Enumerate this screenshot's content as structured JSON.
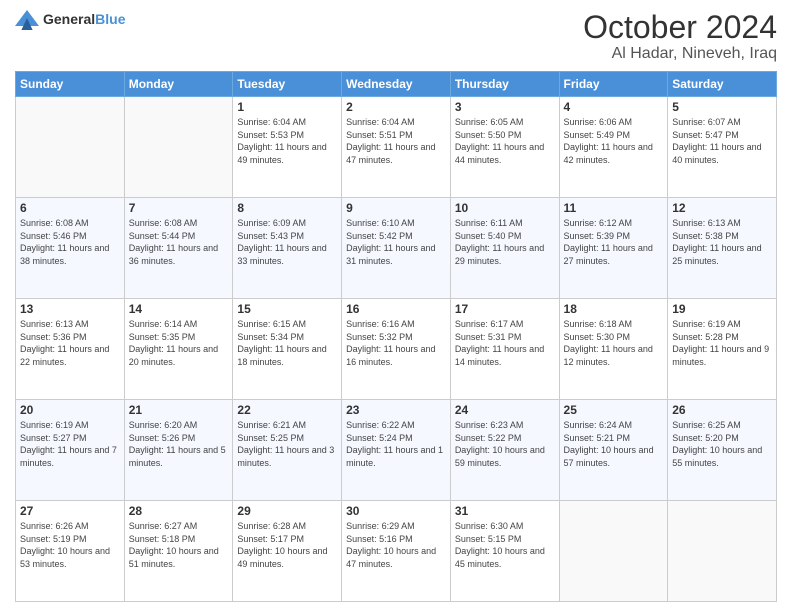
{
  "header": {
    "logo_general": "General",
    "logo_blue": "Blue",
    "month_title": "October 2024",
    "location": "Al Hadar, Nineveh, Iraq"
  },
  "weekdays": [
    "Sunday",
    "Monday",
    "Tuesday",
    "Wednesday",
    "Thursday",
    "Friday",
    "Saturday"
  ],
  "weeks": [
    [
      {
        "day": "",
        "sunrise": "",
        "sunset": "",
        "daylight": ""
      },
      {
        "day": "",
        "sunrise": "",
        "sunset": "",
        "daylight": ""
      },
      {
        "day": "1",
        "sunrise": "Sunrise: 6:04 AM",
        "sunset": "Sunset: 5:53 PM",
        "daylight": "Daylight: 11 hours and 49 minutes."
      },
      {
        "day": "2",
        "sunrise": "Sunrise: 6:04 AM",
        "sunset": "Sunset: 5:51 PM",
        "daylight": "Daylight: 11 hours and 47 minutes."
      },
      {
        "day": "3",
        "sunrise": "Sunrise: 6:05 AM",
        "sunset": "Sunset: 5:50 PM",
        "daylight": "Daylight: 11 hours and 44 minutes."
      },
      {
        "day": "4",
        "sunrise": "Sunrise: 6:06 AM",
        "sunset": "Sunset: 5:49 PM",
        "daylight": "Daylight: 11 hours and 42 minutes."
      },
      {
        "day": "5",
        "sunrise": "Sunrise: 6:07 AM",
        "sunset": "Sunset: 5:47 PM",
        "daylight": "Daylight: 11 hours and 40 minutes."
      }
    ],
    [
      {
        "day": "6",
        "sunrise": "Sunrise: 6:08 AM",
        "sunset": "Sunset: 5:46 PM",
        "daylight": "Daylight: 11 hours and 38 minutes."
      },
      {
        "day": "7",
        "sunrise": "Sunrise: 6:08 AM",
        "sunset": "Sunset: 5:44 PM",
        "daylight": "Daylight: 11 hours and 36 minutes."
      },
      {
        "day": "8",
        "sunrise": "Sunrise: 6:09 AM",
        "sunset": "Sunset: 5:43 PM",
        "daylight": "Daylight: 11 hours and 33 minutes."
      },
      {
        "day": "9",
        "sunrise": "Sunrise: 6:10 AM",
        "sunset": "Sunset: 5:42 PM",
        "daylight": "Daylight: 11 hours and 31 minutes."
      },
      {
        "day": "10",
        "sunrise": "Sunrise: 6:11 AM",
        "sunset": "Sunset: 5:40 PM",
        "daylight": "Daylight: 11 hours and 29 minutes."
      },
      {
        "day": "11",
        "sunrise": "Sunrise: 6:12 AM",
        "sunset": "Sunset: 5:39 PM",
        "daylight": "Daylight: 11 hours and 27 minutes."
      },
      {
        "day": "12",
        "sunrise": "Sunrise: 6:13 AM",
        "sunset": "Sunset: 5:38 PM",
        "daylight": "Daylight: 11 hours and 25 minutes."
      }
    ],
    [
      {
        "day": "13",
        "sunrise": "Sunrise: 6:13 AM",
        "sunset": "Sunset: 5:36 PM",
        "daylight": "Daylight: 11 hours and 22 minutes."
      },
      {
        "day": "14",
        "sunrise": "Sunrise: 6:14 AM",
        "sunset": "Sunset: 5:35 PM",
        "daylight": "Daylight: 11 hours and 20 minutes."
      },
      {
        "day": "15",
        "sunrise": "Sunrise: 6:15 AM",
        "sunset": "Sunset: 5:34 PM",
        "daylight": "Daylight: 11 hours and 18 minutes."
      },
      {
        "day": "16",
        "sunrise": "Sunrise: 6:16 AM",
        "sunset": "Sunset: 5:32 PM",
        "daylight": "Daylight: 11 hours and 16 minutes."
      },
      {
        "day": "17",
        "sunrise": "Sunrise: 6:17 AM",
        "sunset": "Sunset: 5:31 PM",
        "daylight": "Daylight: 11 hours and 14 minutes."
      },
      {
        "day": "18",
        "sunrise": "Sunrise: 6:18 AM",
        "sunset": "Sunset: 5:30 PM",
        "daylight": "Daylight: 11 hours and 12 minutes."
      },
      {
        "day": "19",
        "sunrise": "Sunrise: 6:19 AM",
        "sunset": "Sunset: 5:28 PM",
        "daylight": "Daylight: 11 hours and 9 minutes."
      }
    ],
    [
      {
        "day": "20",
        "sunrise": "Sunrise: 6:19 AM",
        "sunset": "Sunset: 5:27 PM",
        "daylight": "Daylight: 11 hours and 7 minutes."
      },
      {
        "day": "21",
        "sunrise": "Sunrise: 6:20 AM",
        "sunset": "Sunset: 5:26 PM",
        "daylight": "Daylight: 11 hours and 5 minutes."
      },
      {
        "day": "22",
        "sunrise": "Sunrise: 6:21 AM",
        "sunset": "Sunset: 5:25 PM",
        "daylight": "Daylight: 11 hours and 3 minutes."
      },
      {
        "day": "23",
        "sunrise": "Sunrise: 6:22 AM",
        "sunset": "Sunset: 5:24 PM",
        "daylight": "Daylight: 11 hours and 1 minute."
      },
      {
        "day": "24",
        "sunrise": "Sunrise: 6:23 AM",
        "sunset": "Sunset: 5:22 PM",
        "daylight": "Daylight: 10 hours and 59 minutes."
      },
      {
        "day": "25",
        "sunrise": "Sunrise: 6:24 AM",
        "sunset": "Sunset: 5:21 PM",
        "daylight": "Daylight: 10 hours and 57 minutes."
      },
      {
        "day": "26",
        "sunrise": "Sunrise: 6:25 AM",
        "sunset": "Sunset: 5:20 PM",
        "daylight": "Daylight: 10 hours and 55 minutes."
      }
    ],
    [
      {
        "day": "27",
        "sunrise": "Sunrise: 6:26 AM",
        "sunset": "Sunset: 5:19 PM",
        "daylight": "Daylight: 10 hours and 53 minutes."
      },
      {
        "day": "28",
        "sunrise": "Sunrise: 6:27 AM",
        "sunset": "Sunset: 5:18 PM",
        "daylight": "Daylight: 10 hours and 51 minutes."
      },
      {
        "day": "29",
        "sunrise": "Sunrise: 6:28 AM",
        "sunset": "Sunset: 5:17 PM",
        "daylight": "Daylight: 10 hours and 49 minutes."
      },
      {
        "day": "30",
        "sunrise": "Sunrise: 6:29 AM",
        "sunset": "Sunset: 5:16 PM",
        "daylight": "Daylight: 10 hours and 47 minutes."
      },
      {
        "day": "31",
        "sunrise": "Sunrise: 6:30 AM",
        "sunset": "Sunset: 5:15 PM",
        "daylight": "Daylight: 10 hours and 45 minutes."
      },
      {
        "day": "",
        "sunrise": "",
        "sunset": "",
        "daylight": ""
      },
      {
        "day": "",
        "sunrise": "",
        "sunset": "",
        "daylight": ""
      }
    ]
  ]
}
